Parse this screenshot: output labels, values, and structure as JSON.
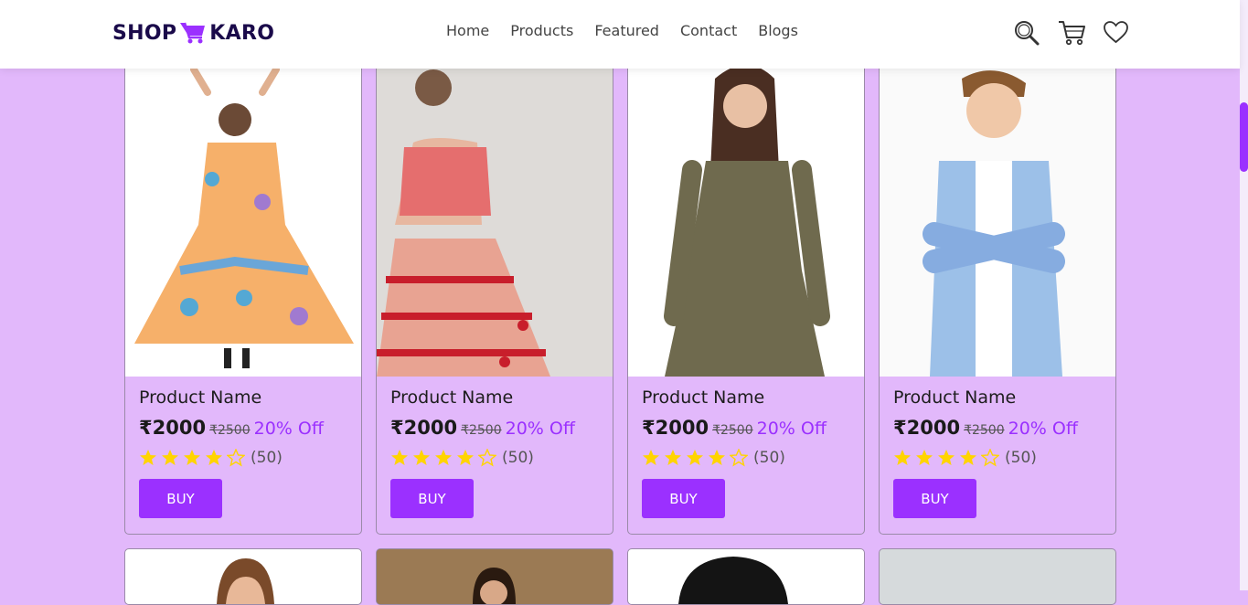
{
  "header": {
    "logo_left": "SHOP",
    "logo_right": "KARO",
    "nav": [
      "Home",
      "Products",
      "Featured",
      "Contact",
      "Blogs"
    ],
    "icons": [
      "search-icon",
      "cart-icon",
      "heart-icon"
    ]
  },
  "colors": {
    "accent": "#9b30ff",
    "page_bg": "#e2b8fb",
    "star": "#ffd400"
  },
  "products": [
    {
      "name": "Product Name",
      "price": "₹2000",
      "old_price": "₹2500",
      "discount": "20% Off",
      "rating": 4,
      "reviews": "(50)",
      "buy": "BUY"
    },
    {
      "name": "Product Name",
      "price": "₹2000",
      "old_price": "₹2500",
      "discount": "20% Off",
      "rating": 4,
      "reviews": "(50)",
      "buy": "BUY"
    },
    {
      "name": "Product Name",
      "price": "₹2000",
      "old_price": "₹2500",
      "discount": "20% Off",
      "rating": 4,
      "reviews": "(50)",
      "buy": "BUY"
    },
    {
      "name": "Product Name",
      "price": "₹2000",
      "old_price": "₹2500",
      "discount": "20% Off",
      "rating": 4,
      "reviews": "(50)",
      "buy": "BUY"
    }
  ]
}
